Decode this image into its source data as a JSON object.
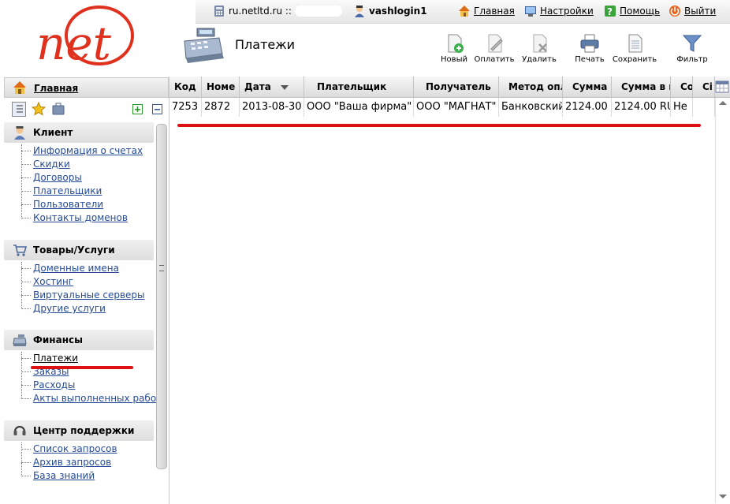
{
  "brand": {
    "logo_text": "net"
  },
  "topbar": {
    "domain": "ru.netltd.ru ::",
    "login": "vashlogin1",
    "home_label": "Главная",
    "settings_label": "Настройки",
    "help_label": "Помощь",
    "exit_label": "Выйти"
  },
  "page": {
    "title": "Платежи"
  },
  "toolbar": {
    "new": "Новый",
    "pay": "Оплатить",
    "delete": "Удалить",
    "print": "Печать",
    "save": "Сохранить",
    "filter": "Фильтр"
  },
  "sidebar": {
    "home": "Главная",
    "sections": [
      {
        "title": "Клиент",
        "items": [
          "Информация о счетах",
          "Скидки",
          "Договоры",
          "Плательщики",
          "Пользователи",
          "Контакты доменов"
        ]
      },
      {
        "title": "Товары/Услуги",
        "items": [
          "Доменные имена",
          "Хостинг",
          "Виртуальные серверы",
          "Другие услуги"
        ]
      },
      {
        "title": "Финансы",
        "items": [
          "Платежи",
          "Заказы",
          "Расходы",
          "Акты выполненных работ"
        ]
      },
      {
        "title": "Центр поддержки",
        "items": [
          "Список запросов",
          "Архив запросов",
          "База знаний"
        ]
      }
    ]
  },
  "grid": {
    "columns": [
      "Код",
      "Номе",
      "Дата",
      "Плательщик",
      "Получатель",
      "Метод опл",
      "Сумма",
      "Сумма в в",
      "Со",
      "Сі"
    ],
    "rows": [
      [
        "7253",
        "2872",
        "2013-08-30",
        "ООО \"Ваша фирма\"",
        "ООО \"МАГНАТ\"",
        "Банковский",
        "2124.00",
        "2124.00 RU",
        "Не",
        ""
      ]
    ]
  },
  "colors": {
    "brand_red": "#e0301e",
    "link_blue": "#264b96",
    "highlight_red": "#dd1111"
  }
}
